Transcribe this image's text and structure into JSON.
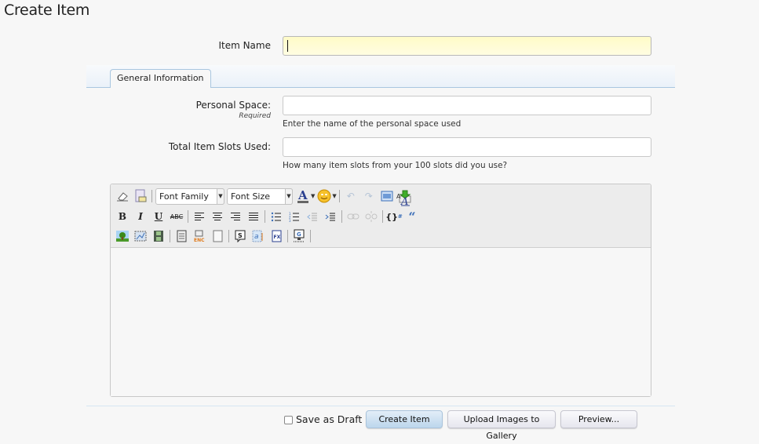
{
  "page": {
    "title": "Create Item"
  },
  "item_name": {
    "label": "Item Name",
    "value": "",
    "placeholder": ""
  },
  "tabs": [
    {
      "label": "General Information",
      "active": true
    }
  ],
  "fields": {
    "personal_space": {
      "label": "Personal Space:",
      "required_note": "Required",
      "value": "",
      "hint": "Enter the name of the personal space used"
    },
    "total_slots": {
      "label": "Total Item Slots Used:",
      "value": "",
      "hint": "How many item slots from your 100 slots did you use?"
    }
  },
  "editor": {
    "font_family": "Font Family",
    "font_size": "Font Size",
    "toolbar_row1": [
      "eraser-icon",
      "paste-text-icon",
      "font-family-select",
      "font-size-select",
      "text-color-icon",
      "smiley-icon",
      "undo-icon",
      "redo-icon",
      "fullscreen-icon",
      "save-draft-icon",
      "toggle-editor-mode-icon"
    ],
    "toolbar_row2": [
      "bold-icon",
      "italic-icon",
      "underline-icon",
      "strikethrough-icon",
      "align-left-icon",
      "align-center-icon",
      "align-right-icon",
      "align-justify-icon",
      "bullet-list-icon",
      "numbered-list-icon",
      "outdent-icon",
      "indent-icon",
      "link-icon",
      "unlink-icon",
      "code-icon",
      "quote-icon"
    ],
    "toolbar_row3": [
      "insert-image-icon",
      "insert-media-icon",
      "insert-video-icon",
      "page-icon",
      "encode-icon",
      "blank-page-icon",
      "spoiler-icon",
      "anchor-icon",
      "formula-icon",
      "gallery-icon"
    ],
    "content": ""
  },
  "footer": {
    "save_as_draft": {
      "label": "Save as Draft",
      "checked": false
    },
    "buttons": {
      "create": "Create Item",
      "upload": "Upload Images to Gallery",
      "preview": "Preview..."
    }
  },
  "colors": {
    "accent": "#a9c6e0",
    "focus_input": "#fffbc7",
    "primary_button": "#bcd6ec"
  }
}
